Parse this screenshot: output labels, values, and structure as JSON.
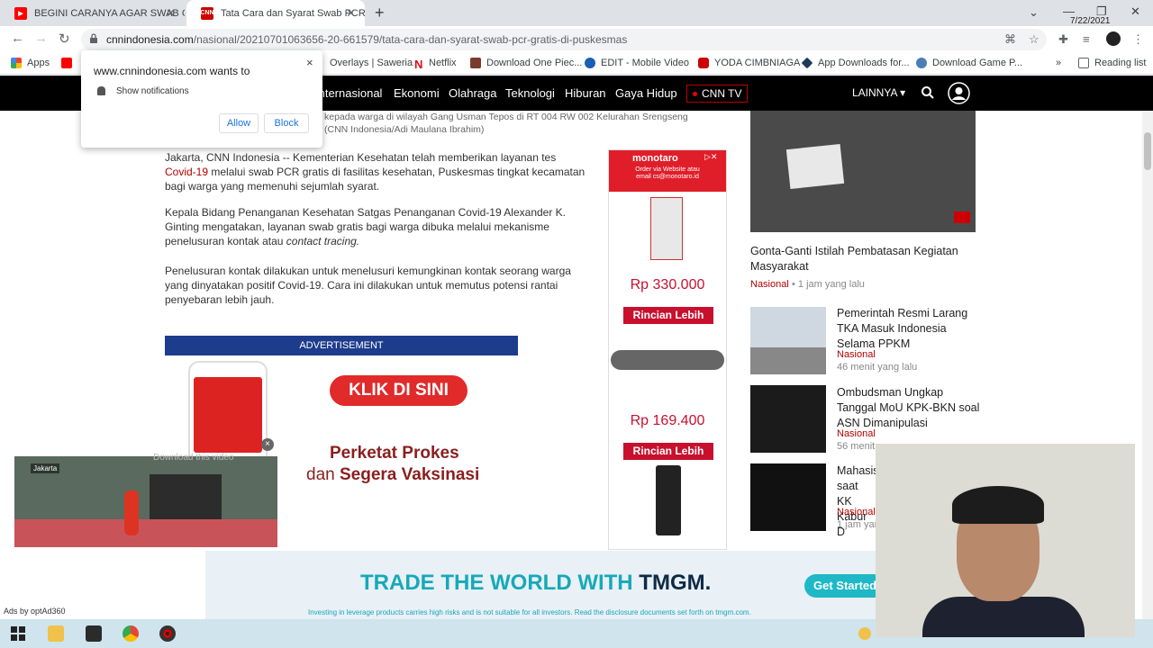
{
  "browser": {
    "tabs": [
      {
        "title": "BEGINI CARANYA AGAR SWAB G",
        "favicon": "youtube-icon",
        "active": false
      },
      {
        "title": "Tata Cara dan Syarat Swab PCR G",
        "favicon": "cnn-icon",
        "active": true
      }
    ],
    "new_tab_label": "+",
    "url_domain": "cnnindonesia.com",
    "url_path": "/nasional/20210701063656-20-661579/tata-cara-dan-syarat-swab-pcr-gratis-di-puskesmas",
    "bookmarks": [
      {
        "label": "Apps"
      },
      {
        "label": "Overlays | Saweria"
      },
      {
        "label": "Netflix"
      },
      {
        "label": "Download One Piec..."
      },
      {
        "label": "EDIT - Mobile Video"
      },
      {
        "label": "YODA CIMBNIAGA"
      },
      {
        "label": "App Downloads for..."
      },
      {
        "label": "Download Game P..."
      }
    ],
    "bookmarks_more": "»",
    "reading_list": "Reading list"
  },
  "notification": {
    "site": "www.cnnindonesia.com wants to",
    "message": "Show notifications",
    "allow": "Allow",
    "block": "Block",
    "close": "×"
  },
  "cnn_nav": {
    "items": [
      "Internasional",
      "Ekonomi",
      "Olahraga",
      "Teknologi",
      "Hiburan",
      "Gaya Hidup"
    ],
    "tv": "CNN TV",
    "more": "LAINNYA ▾"
  },
  "article": {
    "caption_line1": "kepada warga di wilayah Gang Usman Tepos di RT 004 RW 002 Kelurahan Srengseng",
    "caption_line2": "(CNN Indonesia/Adi Maulana Ibrahim)",
    "p1_a": "Jakarta, CNN Indonesia -- Kementerian Kesehatan telah memberikan layanan tes",
    "p1_link": "Covid-19",
    "p1_b": " melalui swab PCR gratis di fasilitas kesehatan, Puskesmas tingkat kecamatan bagi warga yang memenuhi sejumlah syarat.",
    "p2_a": "Kepala Bidang Penanganan Kesehatan Satgas Penanganan Covid-19 Alexander K. Ginting mengatakan, layanan swab gratis bagi warga dibuka melalui mekanisme penelusuran kontak atau ",
    "p2_ital": "contact tracing.",
    "p3": "Penelusuran kontak dilakukan untuk menelusuri kemungkinan kontak seorang warga yang dinyatakan positif Covid-19. Cara ini dilakukan untuk memutus potensi rantai penyebaran lebih jauh."
  },
  "inline_ad": {
    "header": "ADVERTISEMENT",
    "klik": "KLIK DI SINI",
    "line1": "Perketat Prokes",
    "line2_a": "dan ",
    "line2_b": "Segera Vaksinasi"
  },
  "side_ad": {
    "brand": "monotaro",
    "sub": "Order via Website atau email cs@monotaro.id",
    "price1": "Rp 330.000",
    "price2": "Rp 169.400",
    "cta": "Rincian Lebih"
  },
  "news": [
    {
      "title": "Gonta-Ganti Istilah Pembatasan Kegiatan Masyarakat",
      "category": "Nasional",
      "time": "• 1 jam yang lalu"
    },
    {
      "title": "Pemerintah Resmi Larang TKA Masuk Indonesia Selama PPKM",
      "category": "Nasional",
      "time": "46 menit yang lalu"
    },
    {
      "title": "Ombudsman Ungkap Tanggal MoU KPK-BKN soal ASN Dimanipulasi",
      "category": "Nasional",
      "time": "56 menit"
    },
    {
      "title": "Mahasis saat KK Kabur D",
      "category": "Nasional",
      "time": "1 jam yan"
    }
  ],
  "float_video": {
    "download": "Download this video",
    "location": "Jakarta",
    "close": "×"
  },
  "banner": {
    "headline_a": "TRADE THE WORLD WITH ",
    "headline_b": "TMGM.",
    "cta": "Get Started",
    "disclaimer": "Investing in leverage products carries high risks and is not suitable for all investors. Read the disclosure documents set forth on tmgm.com."
  },
  "ads_by": "Ads by optAd360",
  "taskbar": {
    "date": "7/22/2021"
  },
  "colors": {
    "cnn_red": "#b20000",
    "nav_black": "#000000",
    "ad_blue": "#1e3c8c",
    "tmgm_teal": "#17a9b8"
  }
}
